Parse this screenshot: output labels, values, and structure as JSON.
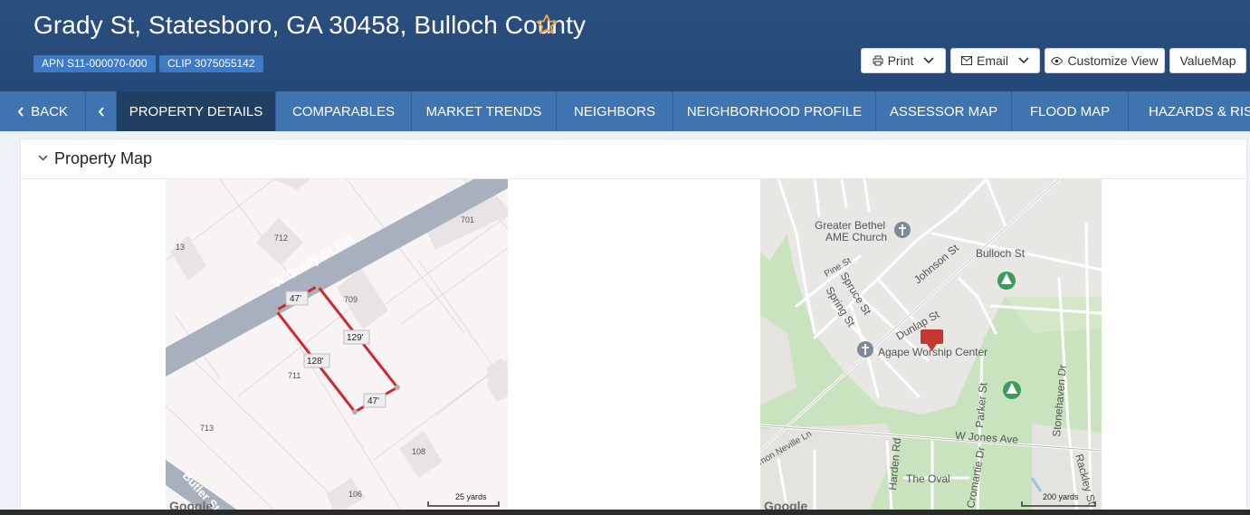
{
  "header": {
    "title": "Grady St, Statesboro, GA 30458, Bulloch County",
    "apn": "APN S11-000070-000",
    "clip": "CLIP 3075055142",
    "buttons": {
      "print": "Print",
      "email": "Email",
      "customize": "Customize View",
      "valuemap": "ValueMap"
    }
  },
  "nav": {
    "back": "BACK",
    "tabs": [
      "PROPERTY DETAILS",
      "COMPARABLES",
      "MARKET TRENDS",
      "NEIGHBORS",
      "NEIGHBORHOOD PROFILE",
      "ASSESSOR MAP",
      "FLOOD MAP",
      "HAZARDS & RISK"
    ],
    "active_tab": "PROPERTY DETAILS"
  },
  "panel": {
    "title": "Property Map"
  },
  "parcel_map": {
    "street": "W Grady St Ext",
    "street2": "Butler St",
    "lots": [
      "13",
      "712",
      "701",
      "709",
      "711",
      "713",
      "108",
      "106"
    ],
    "dimensions": [
      "47'",
      "129'",
      "128'",
      "47'"
    ],
    "scale": "25 yards",
    "logo": "Google"
  },
  "area_map": {
    "labels": {
      "church1": "Greater Bethel",
      "church1b": "AME Church",
      "church2": "Agape Worship Center",
      "pine": "Pine St",
      "spruce": "Spruce St",
      "spring": "Spring St",
      "johnson": "Johnson St",
      "bulloch": "Bulloch St",
      "dunlap": "Dunlap St",
      "parker": "Parker St",
      "stonehaven": "Stonehaven Dr",
      "jones": "W Jones Ave",
      "neville": "mon Neville Ln",
      "harden": "Harden Rd",
      "oval": "The Oval",
      "cromartie": "Cromartie Dr",
      "rackley": "Rackley St"
    },
    "scale": "200 yards",
    "logo": "Google"
  },
  "colors": {
    "header": "#2b4f7e",
    "nav": "#3f74b0",
    "nav_active": "#213e63",
    "badge": "#3f7ac4",
    "parcel": "#cc2b2b",
    "star": "#e8a04a"
  }
}
